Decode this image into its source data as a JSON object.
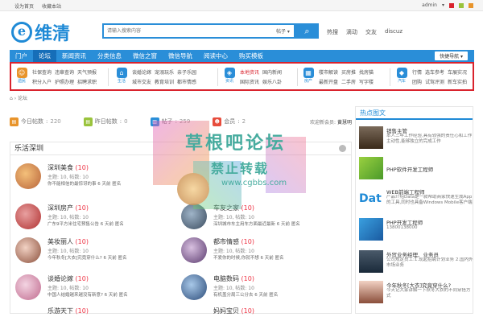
{
  "topbar": {
    "set_home": "设为首页",
    "bookmark": "收藏本站",
    "user": "admin"
  },
  "logo": {
    "mark": "e",
    "text": "维清"
  },
  "search": {
    "placeholder": "请输入搜索内容",
    "type": "帖子",
    "hot": [
      "热搜",
      "滴动",
      "交友",
      "discuz"
    ]
  },
  "nav": {
    "items": [
      "门户",
      "论坛",
      "新闻资讯",
      "分类信息",
      "微信之窗",
      "微信导航",
      "阅读中心",
      "购买模板"
    ],
    "active": 1,
    "quick": "快捷导航"
  },
  "subnav": [
    {
      "icon": "遗民",
      "color": "#e8942b",
      "links": [
        "社保查询",
        "违章查询",
        "天气预报",
        "积分入户",
        "护照办理",
        "招聘求职"
      ]
    },
    {
      "icon": "生活",
      "color": "#2a8ed8",
      "links": [
        "谈婚论嫁",
        "宠溺玩乐",
        "亲子乐园",
        "城市交友",
        "教育培训",
        "都市情感"
      ]
    },
    {
      "icon": "资讯",
      "color": "#2a8ed8",
      "links": [
        "本地资讯",
        "国内新闻",
        "国际资讯",
        "娱乐八卦"
      ],
      "hot": 0
    },
    {
      "icon": "房产",
      "color": "#2a8ed8",
      "links": [
        "楼市解读",
        "买房推",
        "找房猫",
        "最新开盘",
        "二手房",
        "写字楼"
      ]
    },
    {
      "icon": "汽车",
      "color": "#2a8ed8",
      "links": [
        "行情",
        "选车参考",
        "车展实况",
        "团购",
        "试驾评测",
        "新车实拍"
      ]
    }
  ],
  "crumb": "论坛",
  "stats": [
    {
      "label": "今日帖数",
      "value": "220",
      "color": "#e8942b"
    },
    {
      "label": "昨日帖数",
      "value": "0",
      "color": "#9ac33c"
    },
    {
      "label": "帖子",
      "value": "259",
      "color": "#2a8ed8"
    },
    {
      "label": "会员",
      "value": "2",
      "color": "#e74c3c"
    }
  ],
  "stats_right": {
    "label": "欢迎新会员",
    "name": "黄慧明"
  },
  "forum": {
    "title": "乐活深圳",
    "boards": [
      {
        "name": "深圳美食",
        "count": "(10)",
        "meta": "主题: 10, 帖数: 10",
        "last": "你不能相信的最惊讶的事 6 天前 匿名"
      },
      {
        "name": "",
        "count": "",
        "meta": "",
        "last": ""
      },
      {
        "name": "深圳房产",
        "count": "(10)",
        "meta": "主题: 10, 帖数: 10",
        "last": "广东9平方米住宅预售公告 6 天前 匿名"
      },
      {
        "name": "车友之家",
        "count": "(10)",
        "meta": "主题: 10, 帖数: 10",
        "last": "深圳城市车主用车方面最近最新 6 天前 匿名"
      },
      {
        "name": "美妆丽人",
        "count": "(10)",
        "meta": "主题: 10, 帖数: 10",
        "last": "今年秋冬[大衣]究竟穿什么? 6 天前 匿名"
      },
      {
        "name": "都市情感",
        "count": "(10)",
        "meta": "主题: 10, 帖数: 10",
        "last": "不爱你的时候,你就不想 6 天前 匿名"
      },
      {
        "name": "谈婚论嫁",
        "count": "(10)",
        "meta": "主题: 10, 帖数: 10",
        "last": "中国人结婚越来越没有新意? 6 天前 匿名"
      },
      {
        "name": "电脑数码",
        "count": "(10)",
        "meta": "主题: 10, 帖数: 10",
        "last": "有机盖分局三公分去 6 天前 匿名"
      },
      {
        "name": "乐游天下",
        "count": "(10)",
        "meta": "",
        "last": ""
      },
      {
        "name": "妈妈宝贝",
        "count": "(10)",
        "meta": "",
        "last": ""
      }
    ]
  },
  "watermark": {
    "a": "草根吧论坛",
    "b": "禁止转载",
    "c": "www.cgbbs.com"
  },
  "side": {
    "title": "热点图文",
    "items": [
      {
        "title": "销售主管",
        "desc": "本人三年工作经验,具有较强的责任心和工作主动性,能够独立的完成工作"
      },
      {
        "title": "PHP软件开发工程师",
        "desc": ""
      },
      {
        "title": "WEB前端工程师",
        "desc": "产品介绍Data是一款帮助商家快速生成App的工具,同时也具备Windows Mobile客户端"
      },
      {
        "title": "PHP开发工程师",
        "desc": "13800138000"
      },
      {
        "title": "外贸业务经理、业务员",
        "desc": "公司规定员工:1.现起招聘计划业务 2.国内外市场业务"
      },
      {
        "title": "今年秋冬[大衣]究竟穿什么?",
        "desc": "今天记大家讲解一下秋冬大衣的不同穿搭方式"
      }
    ]
  }
}
